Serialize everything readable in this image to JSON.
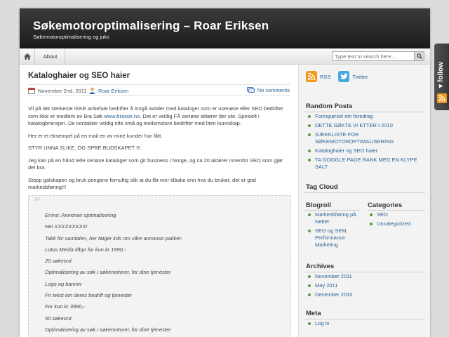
{
  "header": {
    "title": "Søkemotoroptimalisering – Roar Eriksen",
    "description": "Søkemotoroptimalisering og juks"
  },
  "nav": {
    "home_icon": "home-icon",
    "items": [
      {
        "label": "About"
      }
    ]
  },
  "search": {
    "placeholder": "Type text to search here..."
  },
  "post": {
    "title": "Kataloghaier og SEO haier",
    "date": "November 2nd, 2011",
    "author": "Roar Eriksen",
    "comments": "No comments",
    "paragraphs": [
      {
        "before_link": "Vil på det sterkeste IKKE anbefale bedrifter å inngå avtaler med kataloger som er useriøse eller SEO bedrifter som ikke er medlem av Bra Søk ",
        "link": "www.brasok.no",
        "after_link": ". Det er veldig FÅ seriøse aktører der ute. Spesielt i katalogbransjen. De kontakter veldig ofte små og mellomstore bedrifter med liten kunnskap."
      },
      {
        "text": "Her er et eksempel  på en mail en av mine kunder har fått."
      },
      {
        "text": "STYR UNNA SLIKE, OG SPRE BUDSKAPET !!!"
      },
      {
        "text": "Jeg kan på en hånd telle seriøse kataloger som gir business i Norge, og ca 20 aktører innenfor SEO som gjør det bra."
      },
      {
        "text": "Stopp galskapen og bruk pengene fornuftig slik at du får mer tilbake enn hva du bruker, det er god markedsføring!!!"
      }
    ],
    "quote_lines": [
      "Emne: Annonse optimalisering",
      "Hei XXXXXXXXX!",
      "Takk for samtalen, her følger info om våre annonse pakker:",
      "Lotus Media tilbyr for kun kr 1990,-",
      "20 søkeord",
      "Optimalisering av søk i søkemotorer, for dine tjenester",
      "Logo og banner",
      "Fri tekst om deres bedrift og tjenester",
      "For kun kr 3990,-",
      "50 søkeord",
      "Optimalisering av søk i søkemotorer, for dine tjenester"
    ]
  },
  "sidebar": {
    "rss_label": "RSS",
    "twitter_label": "Twitter",
    "random_posts": {
      "heading": "Random Posts",
      "items": [
        "Forespørsel om foredrag",
        "DETTE SØKTE VI ETTER I 2010",
        "SJEKKLISTE FOR SØKEMOTOROPTIMALISERING",
        "Kataloghaier og SEO haier",
        "TA GOOGLE PAGE RANK MED EN KLYPE SALT"
      ]
    },
    "tag_cloud": {
      "heading": "Tag Cloud"
    },
    "blogroll": {
      "heading": "Blogroll",
      "items": [
        "Markedsføring på Nettet",
        "SEO og SEM, Performance Marketing"
      ]
    },
    "categories": {
      "heading": "Categories",
      "items": [
        "SEO",
        "Uncategorized"
      ]
    },
    "archives": {
      "heading": "Archives",
      "items": [
        "November 2011",
        "May 2011",
        "December 2010"
      ]
    },
    "meta": {
      "heading": "Meta",
      "items": [
        "Log in"
      ]
    }
  },
  "follow": {
    "label": "follow"
  }
}
